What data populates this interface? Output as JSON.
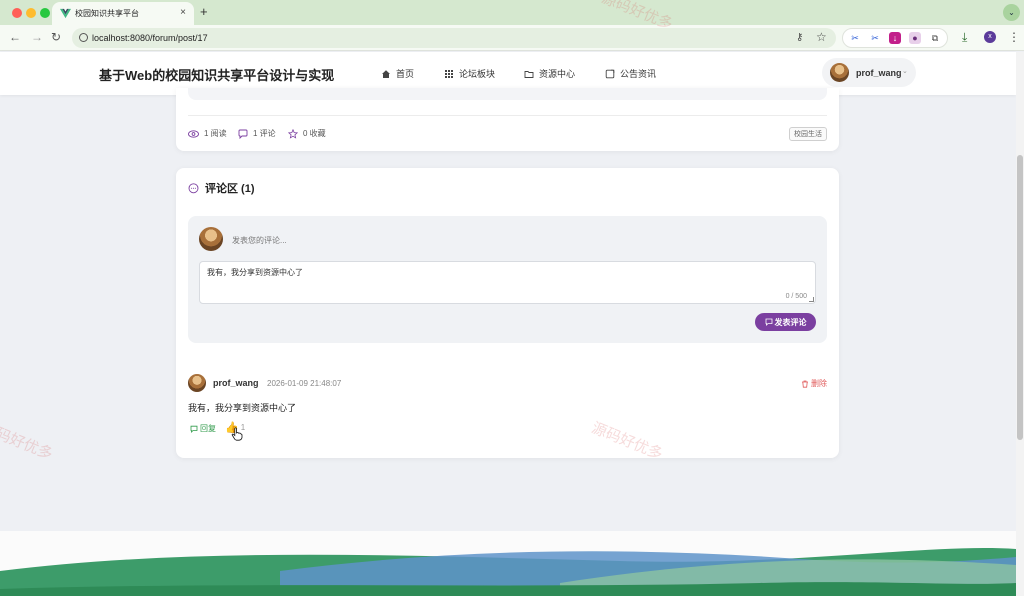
{
  "browser": {
    "tab_title": "校园知识共享平台",
    "tab_close": "×",
    "new_tab": "+",
    "tab_menu_icon": "chevron-down-icon",
    "url": "localhost:8080/forum/post/17",
    "profile_initial": "x",
    "colors": {
      "tabbar": "#d5e8cf",
      "toolbar": "#f6faf4"
    }
  },
  "header": {
    "site_title": "基于Web的校园知识共享平台设计与实现",
    "nav": [
      {
        "label": "首页",
        "icon": "home-icon"
      },
      {
        "label": "论坛板块",
        "icon": "grid-icon"
      },
      {
        "label": "资源中心",
        "icon": "folder-icon"
      },
      {
        "label": "公告资讯",
        "icon": "notice-icon"
      }
    ],
    "user": {
      "name": "prof_wang",
      "caret": "⌄"
    }
  },
  "post": {
    "stats": [
      {
        "label": "1 阅读",
        "icon": "eye-icon"
      },
      {
        "label": "1 评论",
        "icon": "comment-icon"
      },
      {
        "label": "0 收藏",
        "icon": "star-icon"
      }
    ],
    "tag": "校园生活"
  },
  "comments": {
    "title": "评论区 (1)",
    "compose": {
      "hint": "发表您的评论...",
      "draft": "我有，我分享到资源中心了",
      "counter": "0 / 500",
      "submit_label": "发表评论"
    },
    "items": [
      {
        "author": "prof_wang",
        "time": "2026-01-09 21:48:07",
        "body": "我有，我分享到资源中心了",
        "reply_label": "回复",
        "like_count": "1",
        "delete_label": "删除"
      }
    ]
  },
  "watermark": "源码好优多",
  "colors": {
    "accent": "#7b3fa0",
    "reply": "#2f9a4a",
    "delete": "#e05a5a"
  }
}
